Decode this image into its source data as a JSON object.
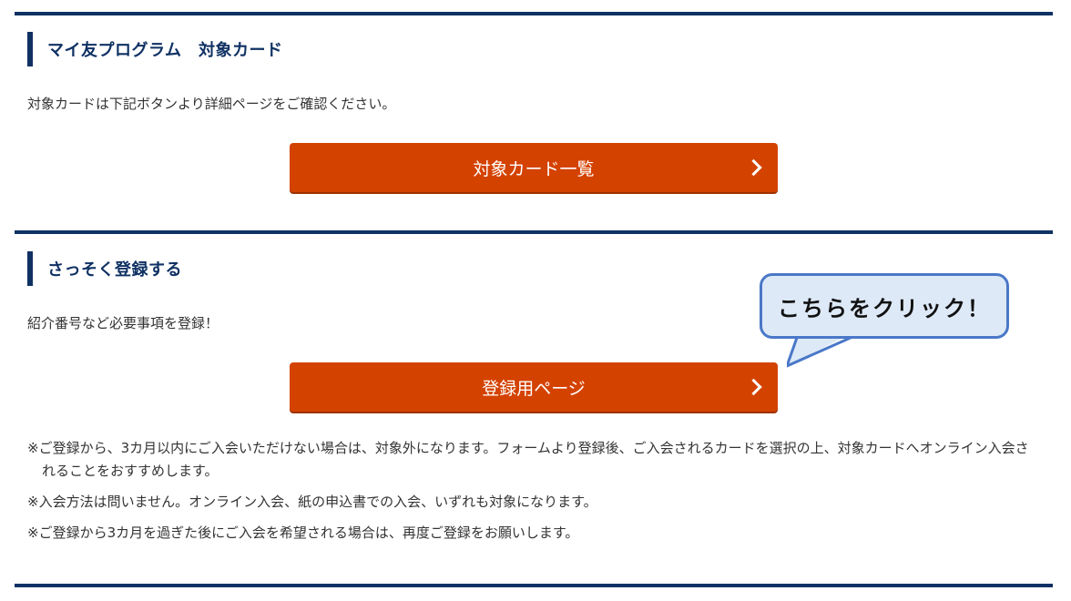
{
  "section1": {
    "heading": "マイ友プログラム　対象カード",
    "description": "対象カードは下記ボタンより詳細ページをご確認ください。",
    "button_label": "対象カード一覧"
  },
  "section2": {
    "heading": "さっそく登録する",
    "description": "紹介番号など必要事項を登録！",
    "button_label": "登録用ページ",
    "notes": [
      "※ご登録から、3カ月以内にご入会いただけない場合は、対象外になります。フォームより登録後、ご入会されるカードを選択の上、対象カードへオンライン入会されることをおすすめします。",
      "※入会方法は問いません。オンライン入会、紙の申込書での入会、いずれも対象になります。",
      "※ご登録から3カ月を過ぎた後にご入会を希望される場合は、再度ご登録をお願いします。"
    ]
  },
  "callout": {
    "text": "こちらをクリック！"
  },
  "colors": {
    "navy": "#0f3163",
    "button": "#d44200",
    "callout_fill": "#dde9f7",
    "callout_border": "#4a78c8"
  },
  "icons": {
    "button_arrow": "chevron-right-icon"
  }
}
